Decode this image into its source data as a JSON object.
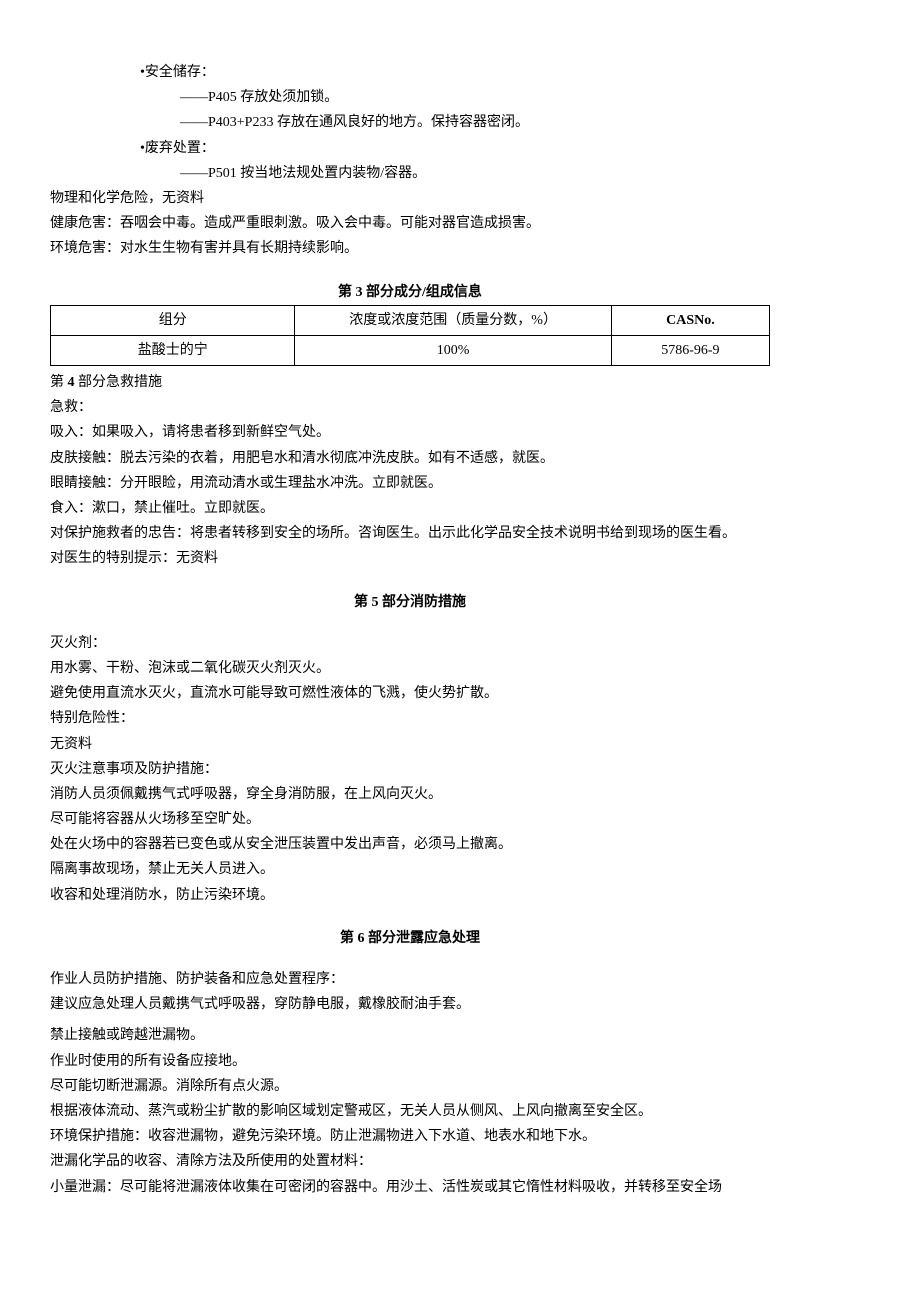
{
  "storage": {
    "heading": "•安全储存：",
    "p405": "——P405 存放处须加锁。",
    "p403_p233": "——P403+P233 存放在通风良好的地方。保持容器密闭。"
  },
  "disposal": {
    "heading": "•废弃处置：",
    "p501": "——P501 按当地法规处置内装物/容器。"
  },
  "hazards": {
    "physical": "物理和化学危险，无资料",
    "health": "健康危害：吞咽会中毒。造成严重眼刺激。吸入会中毒。可能对器官造成损害。",
    "environment": "环境危害：对水生生物有害并具有长期持续影响。"
  },
  "section3": {
    "title": "第 3 部分成分/组成信息",
    "headers": {
      "component": "组分",
      "concentration": "浓度或浓度范围（质量分数，%）",
      "cas": "CASNo."
    },
    "row": {
      "component": "盐酸士的宁",
      "concentration": "100%",
      "cas": "5786-96-9"
    }
  },
  "section4": {
    "title": "第 4 部分急救措施",
    "first_aid_label": "急救：",
    "inhalation": "吸入：如果吸入，请将患者移到新鲜空气处。",
    "skin": "皮肤接触：脱去污染的衣着，用肥皂水和清水彻底冲洗皮肤。如有不适感，就医。",
    "eye": "眼睛接触：分开眼睑，用流动清水或生理盐水冲洗。立即就医。",
    "ingestion": "食入：漱口，禁止催吐。立即就医。",
    "rescuer": "对保护施救者的忠告：将患者转移到安全的场所。咨询医生。出示此化学品安全技术说明书给到现场的医生看。",
    "doctor": "对医生的特别提示：无资料"
  },
  "section5": {
    "title": "第 5 部分消防措施",
    "extinguisher_label": "灭火剂：",
    "extinguisher_text": "用水雾、干粉、泡沫或二氧化碳灭火剂灭火。",
    "avoid": "避免使用直流水灭火，直流水可能导致可燃性液体的飞溅，使火势扩散。",
    "special_hazard_label": "特别危险性：",
    "special_hazard_text": "无资料",
    "precaution_label": "灭火注意事项及防护措施：",
    "p1": "消防人员须佩戴携气式呼吸器，穿全身消防服，在上风向灭火。",
    "p2": "尽可能将容器从火场移至空旷处。",
    "p3": "处在火场中的容器若已变色或从安全泄压装置中发出声音，必须马上撤离。",
    "p4": "隔离事故现场，禁止无关人员进入。",
    "p5": "收容和处理消防水，防止污染环境。"
  },
  "section6": {
    "title": "第 6 部分泄露应急处理",
    "personnel_label": "作业人员防护措施、防护装备和应急处置程序：",
    "p1": "建议应急处理人员戴携气式呼吸器，穿防静电服，戴橡胶耐油手套。",
    "p2": "禁止接触或跨越泄漏物。",
    "p3": "作业时使用的所有设备应接地。",
    "p4": "尽可能切断泄漏源。消除所有点火源。",
    "p5": "根据液体流动、蒸汽或粉尘扩散的影响区域划定警戒区，无关人员从侧风、上风向撤离至安全区。",
    "env": "环境保护措施：收容泄漏物，避免污染环境。防止泄漏物进入下水道、地表水和地下水。",
    "cleanup_label": "泄漏化学品的收容、清除方法及所使用的处置材料：",
    "small_spill": "小量泄漏：尽可能将泄漏液体收集在可密闭的容器中。用沙土、活性炭或其它惰性材料吸收，并转移至安全场"
  }
}
